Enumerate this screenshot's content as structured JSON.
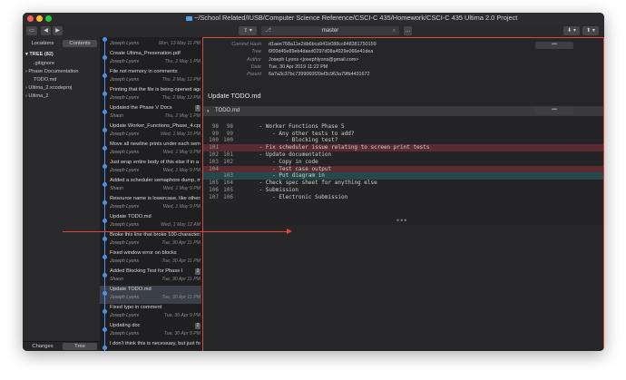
{
  "window": {
    "title": "~/School Related/IUSB/Computer Science Reference/CSCI-C 435/Homework/CSCI-C 435 Ultima 2.0 Project"
  },
  "toolbar": {
    "branch": "master"
  },
  "sidebar": {
    "tabs": [
      "Locations",
      "Contents"
    ],
    "tree_title": "TREE (82)",
    "tree_items": [
      ".gitignore",
      "Phase Documentation",
      "TODO.md",
      "Ultima_2.xcodeproj",
      "Ultima_2"
    ],
    "bottom_tabs": [
      "Changes",
      "Tree"
    ]
  },
  "commits": [
    {
      "msg": "Update .gitignore",
      "author": "Joseph Lyons",
      "date": "Mon, 13 May 11 PM",
      "badge": ""
    },
    {
      "msg": "Create Ultima_Presenation.pdf",
      "author": "Joseph Lyons",
      "date": "Thu, 2 May 1 PM",
      "badge": ""
    },
    {
      "msg": "File not memory in comments",
      "author": "Joseph Lyons",
      "date": "Thu, 2 May 12 PM",
      "badge": ""
    },
    {
      "msg": "Printing that the file is being opened agai",
      "author": "Joseph Lyons",
      "date": "Thu, 2 May 12 PM",
      "badge": ""
    },
    {
      "msg": "Updated the Phase V Docs",
      "author": "Shaun",
      "date": "Thu, 2 May 1 PM",
      "badge": "2"
    },
    {
      "msg": "Update Worker_Functions_Phase_4.cpp",
      "author": "Joseph Lyons",
      "date": "Wed, 1 May 10 PM",
      "badge": ""
    },
    {
      "msg": "Move all newline prints under each sema",
      "author": "Joseph Lyons",
      "date": "Wed, 1 May 9 PM",
      "badge": ""
    },
    {
      "msg": "Just wrap entire body of this else if in a c",
      "author": "Joseph Lyons",
      "date": "Wed, 1 May 9 PM",
      "badge": ""
    },
    {
      "msg": "Added a scheduler semaphore dump, ma",
      "author": "Shaun",
      "date": "Wed, 1 May 9 PM",
      "badge": ""
    },
    {
      "msg": "Resource name is lowercase, like others",
      "author": "Joseph Lyons",
      "date": "Wed, 1 May 9 PM",
      "badge": ""
    },
    {
      "msg": "Update TODO.md",
      "author": "Joseph Lyons",
      "date": "Wed, 1 May 12 AM",
      "badge": ""
    },
    {
      "msg": "Broke this line that broke 100 characters",
      "author": "Joseph Lyons",
      "date": "Tue, 30 Apr 11 PM",
      "badge": ""
    },
    {
      "msg": "Fixed window error on blocks",
      "author": "Joseph Lyons",
      "date": "Tue, 30 Apr 11 PM",
      "badge": ""
    },
    {
      "msg": "Added Blocking Test for Phase I",
      "author": "Shaun",
      "date": "Tue, 30 Apr 11 PM",
      "badge": "2"
    },
    {
      "msg": "Update TODO.md",
      "author": "Joseph Lyons",
      "date": "Tue, 30 Apr 11 PM",
      "badge": ""
    },
    {
      "msg": "Fixed typo in comment",
      "author": "Joseph Lyons",
      "date": "Tue, 30 Apr 9 PM",
      "badge": ""
    },
    {
      "msg": "Updating doc",
      "author": "Joseph Lyons",
      "date": "Tue, 30 Apr 9 PM",
      "badge": "2"
    },
    {
      "msg": "I don't think this is necessary, but just fo",
      "author": "",
      "date": "",
      "badge": ""
    }
  ],
  "detail": {
    "meta": [
      {
        "label": "Commit Hash",
        "value": "d1aee768a11e2db6bca941b088cc848381750159"
      },
      {
        "label": "Tree",
        "value": "6f00d45e89eb4daed0297d08a4929e066e41dea"
      },
      {
        "label": "Author",
        "value": "Joseph Lyons <josephlyons@gmail.com>"
      },
      {
        "label": "Date",
        "value": "Tue, 30 Apr 2019 11:22 PM"
      },
      {
        "label": "Parent",
        "value": "6a7a3c37bc7399060f20ef3c963a79fb4431672"
      }
    ],
    "meta_button": "•••",
    "subject": "Update TODO.md",
    "file_name": "TODO.md",
    "file_button": "•••",
    "diff": [
      {
        "old": "",
        "new": "",
        "text": "",
        "kind": "ctx"
      },
      {
        "old": "98",
        "new": "98",
        "text": "      - Worker Functions Phase 5",
        "kind": "ctx"
      },
      {
        "old": "99",
        "new": "99",
        "text": "          - Any other tests to add?",
        "kind": "ctx"
      },
      {
        "old": "100",
        "new": "100",
        "text": "              - Blocking test?",
        "kind": "ctx"
      },
      {
        "old": "101",
        "new": "",
        "text": "      - Fix scheduler issue relating to screen print tests",
        "kind": "del"
      },
      {
        "old": "102",
        "new": "101",
        "text": "      - Update documentation",
        "kind": "ctx"
      },
      {
        "old": "103",
        "new": "102",
        "text": "          - Copy in code",
        "kind": "ctx"
      },
      {
        "old": "104",
        "new": "",
        "text": "          - Test case output",
        "kind": "del"
      },
      {
        "old": "",
        "new": "103",
        "text": "          - Put diagram in",
        "kind": "add"
      },
      {
        "old": "105",
        "new": "104",
        "text": "      - Check spec sheet for anything else",
        "kind": "ctx"
      },
      {
        "old": "106",
        "new": "105",
        "text": "      - Submission",
        "kind": "ctx"
      },
      {
        "old": "107",
        "new": "106",
        "text": "          - Electronic Submission",
        "kind": "ctx"
      }
    ],
    "more_indicator": "•••"
  },
  "colors": {
    "accent": "#4e92e6",
    "annotation": "#e0443a",
    "deleted_bg": "#5a2b31",
    "added_bg": "#27484a"
  }
}
